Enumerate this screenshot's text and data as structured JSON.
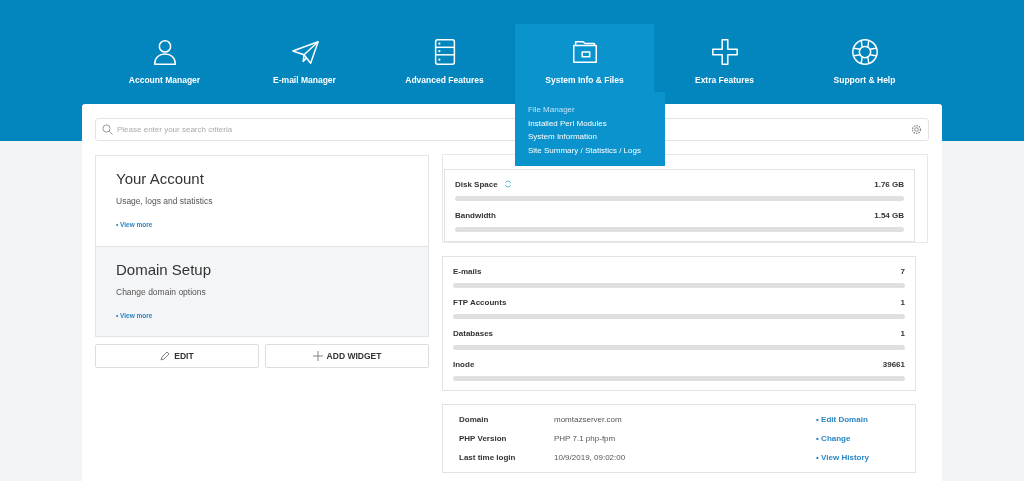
{
  "nav": [
    {
      "label": "Account Manager",
      "selected": false
    },
    {
      "label": "E-mail Manager",
      "selected": false
    },
    {
      "label": "Advanced Features",
      "selected": false
    },
    {
      "label": "System Info & Files",
      "selected": true,
      "menu": [
        {
          "label": "File Manager",
          "selected": true
        },
        {
          "label": "Installed Perl Modules",
          "selected": false
        },
        {
          "label": "System Information",
          "selected": false
        },
        {
          "label": "Site Summary / Statistics / Logs",
          "selected": false
        }
      ]
    },
    {
      "label": "Extra Features",
      "selected": false
    },
    {
      "label": "Support & Help",
      "selected": false
    }
  ],
  "search": {
    "placeholder": "Please enter your search criteria"
  },
  "widgets": [
    {
      "title": "Your Account",
      "subtitle": "Usage, logs and statistics",
      "link": "• View more",
      "selected": false
    },
    {
      "title": "Domain Setup",
      "subtitle": "Change domain options",
      "link": "• View more",
      "selected": true
    }
  ],
  "buttons": [
    {
      "kind": "edit",
      "label": "EDIT"
    },
    {
      "kind": "add",
      "label": "ADD WIDGET"
    }
  ],
  "usage_groups": [
    [
      {
        "name": "Disk Space",
        "value": "1.76 GB",
        "level": 0,
        "refresh": true
      },
      {
        "name": "Bandwidth",
        "value": "1.54 GB",
        "level": 0,
        "refresh": false
      }
    ],
    [
      {
        "name": "E-mails",
        "value": "7",
        "level": 0,
        "refresh": false
      },
      {
        "name": "FTP Accounts",
        "value": "1",
        "level": 0,
        "refresh": false
      },
      {
        "name": "Databases",
        "value": "1",
        "level": 0,
        "refresh": false
      },
      {
        "name": "Inode",
        "value": "39661",
        "level": 0,
        "refresh": false
      }
    ]
  ],
  "info": [
    {
      "label": "Domain",
      "value": "momtazserver.com",
      "action": "• Edit Domain"
    },
    {
      "label": "PHP Version",
      "value": "PHP 7.1 php-fpm",
      "action": "• Change"
    },
    {
      "label": "Last time login",
      "value": "10/9/2019, 09:02:00",
      "action": "• View History"
    }
  ]
}
